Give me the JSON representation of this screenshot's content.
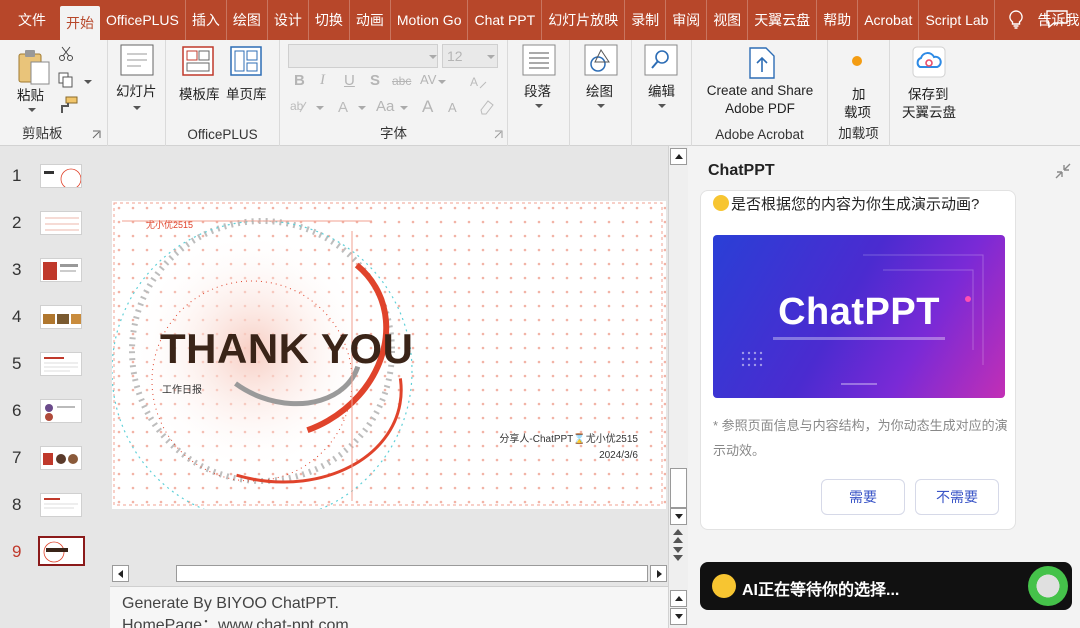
{
  "menu": {
    "tabs": [
      "文件",
      "开始",
      "OfficePLUS",
      "插入",
      "绘图",
      "设计",
      "切换",
      "动画",
      "Motion Go",
      "Chat PPT",
      "幻灯片放映",
      "录制",
      "审阅",
      "视图",
      "天翼云盘",
      "帮助",
      "Acrobat",
      "Script Lab"
    ],
    "active_tab": "开始",
    "tell_me": "告诉我"
  },
  "ribbon": {
    "clipboard": {
      "paste": "粘贴",
      "group": "剪贴板"
    },
    "slides": {
      "slide": "幻灯片"
    },
    "officeplus": {
      "template": "模板库",
      "single": "单页库",
      "group": "OfficePLUS"
    },
    "font": {
      "size": "12",
      "group": "字体",
      "bold": "B",
      "italic": "I",
      "underline": "U",
      "shadow": "S",
      "strike": "abc",
      "spacing": "AV",
      "case": "Aa",
      "grow": "A",
      "shrink": "A"
    },
    "paragraph": {
      "label": "段落"
    },
    "drawing": {
      "label": "绘图"
    },
    "editing": {
      "label": "编辑"
    },
    "acrobat": {
      "line1": "Create and Share",
      "line2": "Adobe PDF",
      "group": "Adobe Acrobat"
    },
    "addins": {
      "line1": "加",
      "line2": "载项",
      "group": "加载项"
    },
    "cloud": {
      "line1": "保存到",
      "line2": "天翼云盘"
    }
  },
  "thumbnails": [
    "1",
    "2",
    "3",
    "4",
    "5",
    "6",
    "7",
    "8",
    "9"
  ],
  "selected_slide": "9",
  "slide": {
    "author_top": "尤小优2515",
    "title": "THANK YOU",
    "subtitle": "工作日报",
    "sharer": "分享人-ChatPPT⌛尤小优2515",
    "date": "2024/3/6"
  },
  "notes": {
    "line1": "Generate By BIYOO ChatPPT.",
    "line2": "HomePage：www.chat-ppt.com"
  },
  "pane": {
    "title": "ChatPPT",
    "question": "是否根据您的内容为你生成演示动画?",
    "banner_title": "ChatPPT",
    "note": "* 参照页面信息与内容结构，为你动态生成对应的演示动效。",
    "yes": "需要",
    "no": "不需要",
    "status": "AI正在等待你的选择..."
  },
  "colors": {
    "accent": "#b7472a",
    "slide_red": "#e0432b",
    "title": "#3a2418"
  }
}
